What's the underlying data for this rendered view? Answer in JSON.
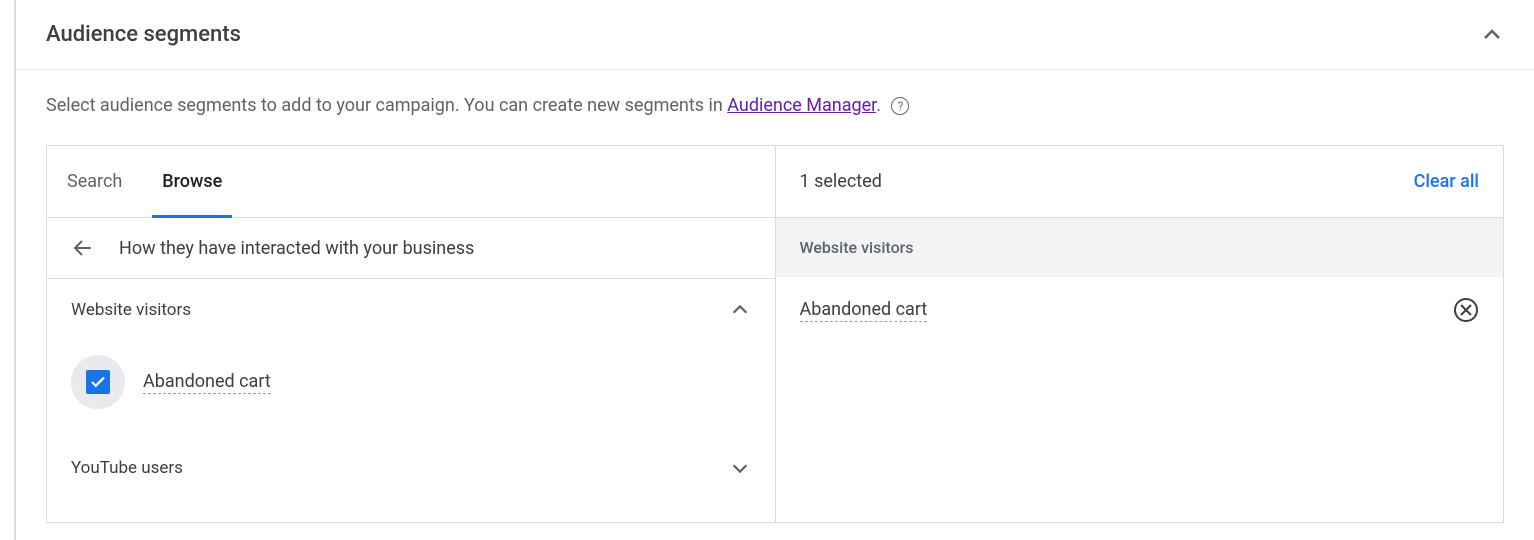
{
  "header": {
    "title": "Audience segments"
  },
  "description": {
    "text_before": "Select audience segments to add to your campaign. You can create new segments in ",
    "link_text": "Audience Manager",
    "text_after": "."
  },
  "tabs": {
    "search": "Search",
    "browse": "Browse"
  },
  "breadcrumb": {
    "label": "How they have interacted with your business"
  },
  "categories": {
    "website_visitors": {
      "label": "Website visitors",
      "items": [
        {
          "label": "Abandoned cart",
          "checked": true
        }
      ]
    },
    "youtube_users": {
      "label": "YouTube users"
    }
  },
  "right": {
    "selected_count": "1 selected",
    "clear_all": "Clear all",
    "group_header": "Website visitors",
    "selected_item": "Abandoned cart"
  }
}
